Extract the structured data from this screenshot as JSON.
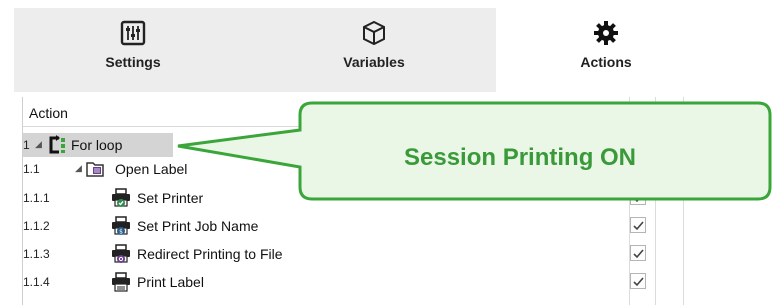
{
  "tabs": [
    {
      "label": "Settings",
      "icon": "settings-sliders-icon",
      "active": false
    },
    {
      "label": "Variables",
      "icon": "variables-cube-icon",
      "active": false
    },
    {
      "label": "Actions",
      "icon": "actions-gear-icon",
      "active": true
    }
  ],
  "grid": {
    "header": "Action",
    "rows": [
      {
        "num": "1",
        "name": "For loop",
        "icon": "for-loop-icon",
        "checked": null,
        "selected": true
      },
      {
        "num": "1.1",
        "name": "Open Label",
        "icon": "open-label-icon",
        "checked": null,
        "selected": false
      },
      {
        "num": "1.1.1",
        "name": "Set Printer",
        "icon": "set-printer-icon",
        "checked": true,
        "selected": false
      },
      {
        "num": "1.1.2",
        "name": "Set Print Job Name",
        "icon": "set-print-job-name-icon",
        "checked": true,
        "selected": false
      },
      {
        "num": "1.1.3",
        "name": "Redirect Printing to File",
        "icon": "redirect-printing-icon",
        "checked": true,
        "selected": false
      },
      {
        "num": "1.1.4",
        "name": "Print Label",
        "icon": "print-label-icon",
        "checked": true,
        "selected": false
      }
    ]
  },
  "callout": {
    "text": "Session Printing ON",
    "color": "#3a9a3a",
    "fill": "#eaf6e6"
  },
  "colors": {
    "accent_green": "#3aa63a",
    "selected_row": "#d4d4d4"
  }
}
